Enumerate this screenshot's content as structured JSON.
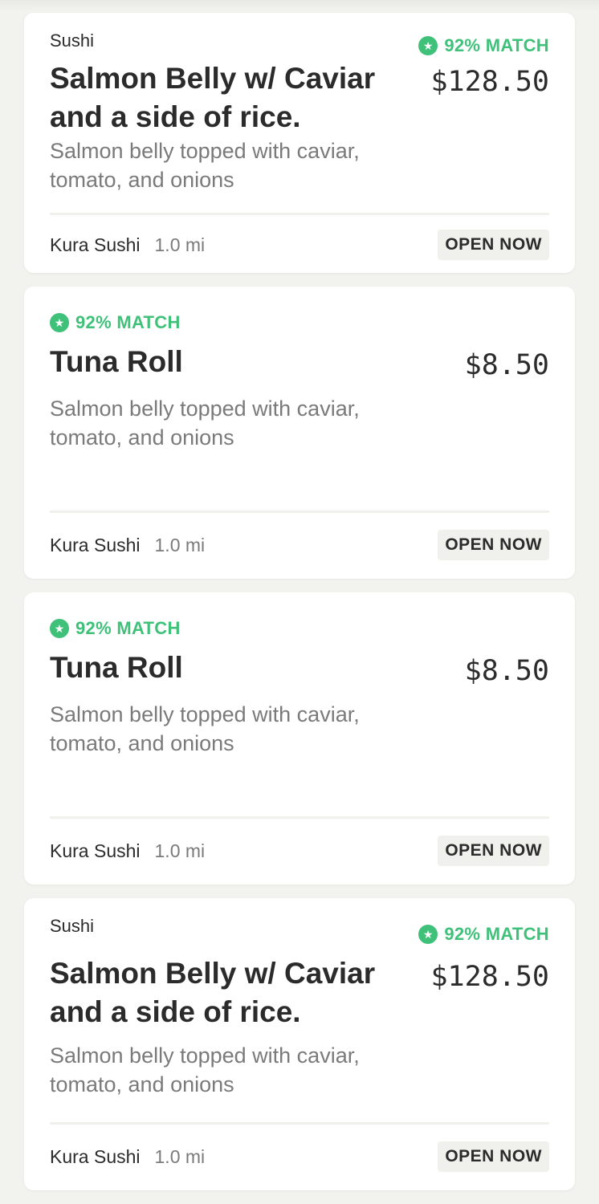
{
  "colors": {
    "background": "#f2f2ef",
    "card": "#ffffff",
    "match_green": "#3fc17a",
    "text_primary": "#2b2b2b",
    "text_secondary": "#7a7a7a"
  },
  "cards": [
    {
      "category": "Sushi",
      "match": "92% MATCH",
      "match_icon": "star-icon",
      "title": "Salmon Belly w/ Caviar and a side of rice.",
      "price": "$128.50",
      "description": "Salmon belly topped with caviar, tomato, and onions",
      "restaurant": "Kura Sushi",
      "distance": "1.0 mi",
      "status": "OPEN NOW"
    },
    {
      "match": "92% MATCH",
      "match_icon": "star-icon",
      "title": "Tuna Roll",
      "price": "$8.50",
      "description": "Salmon belly topped with caviar, tomato, and onions",
      "restaurant": "Kura Sushi",
      "distance": "1.0 mi",
      "status": "OPEN NOW"
    },
    {
      "match": "92% MATCH",
      "match_icon": "star-icon",
      "title": "Tuna Roll",
      "price": "$8.50",
      "description": "Salmon belly topped with caviar, tomato, and onions",
      "restaurant": "Kura Sushi",
      "distance": "1.0 mi",
      "status": "OPEN NOW"
    },
    {
      "category": "Sushi",
      "match": "92% MATCH",
      "match_icon": "star-icon",
      "title": "Salmon Belly w/ Caviar and a side of rice.",
      "price": "$128.50",
      "description": "Salmon belly topped with caviar, tomato, and onions",
      "restaurant": "Kura Sushi",
      "distance": "1.0 mi",
      "status": "OPEN NOW"
    }
  ]
}
